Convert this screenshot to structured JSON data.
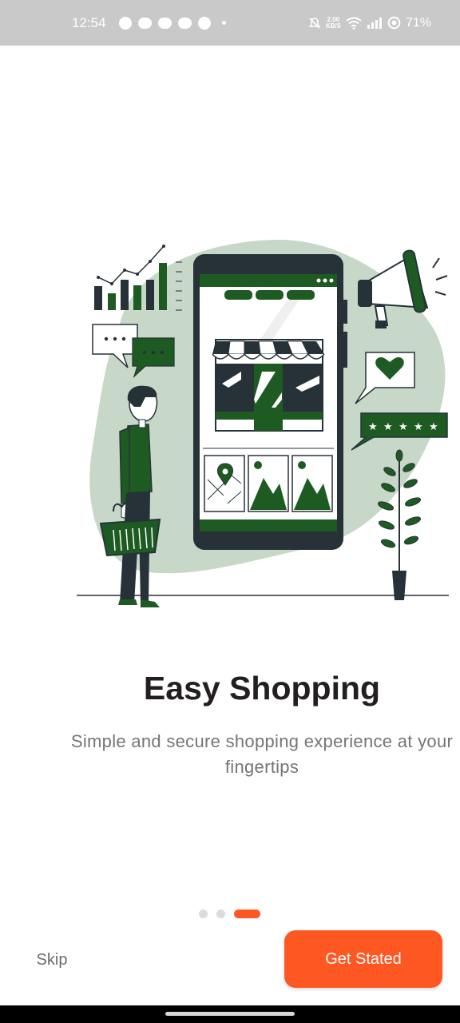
{
  "status_bar": {
    "time": "12:54",
    "net_speed_value": "2.00",
    "net_speed_unit": "KB/S",
    "battery": "71%",
    "icons": [
      "facebook-icon",
      "messenger-icon",
      "messenger-icon",
      "messenger-icon",
      "facebook-icon",
      "mute-icon",
      "wifi-icon",
      "signal-icon",
      "battery-icon"
    ]
  },
  "onboarding": {
    "title": "Easy Shopping",
    "subtitle": "Simple and secure shopping experience at your fingertips",
    "page_count": 3,
    "active_page": 3
  },
  "actions": {
    "skip_label": "Skip",
    "start_label": "Get Stated"
  },
  "colors": {
    "accent": "#ff5722",
    "illustration_green": "#1e5b22",
    "illustration_dark": "#263238",
    "blob": "#c7d7c8"
  }
}
